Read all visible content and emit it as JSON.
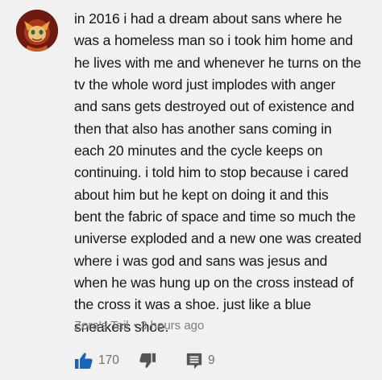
{
  "comment": {
    "lines": [
      "in 2016 i had a dream about sans where he",
      "was a homeless man so i took him home and",
      "he lives with me and whenever he turns on the",
      "tv the whole word just implodes with anger",
      "and sans gets destroyed out of existence and",
      "then that also has another sans coming in",
      "each 20 minutes and the cycle keeps on",
      "continuing. i told him to stop because i cared",
      "about him but he kept on doing it and this",
      "bent the fabric of space and time so much the",
      "universe exploded and a new one was created",
      "where i was god and sans was jesus and",
      "when he was hung up on the cross instead of",
      "the cross it was a shoe. just like a blue",
      "sneakers shoe."
    ],
    "author": "Zora's Tail",
    "separator": "•",
    "timestamp": "3 hours ago",
    "like_count": "170",
    "reply_count": "9"
  },
  "icons": {
    "avatar": "avatar-icon",
    "like": "thumbs-up-icon",
    "dislike": "thumbs-down-icon",
    "reply": "reply-icon"
  },
  "colors": {
    "background": "#f1f1f1",
    "like_active": "#1565c0",
    "muted_text": "#7e7e7e",
    "icon_gray": "#555555"
  }
}
